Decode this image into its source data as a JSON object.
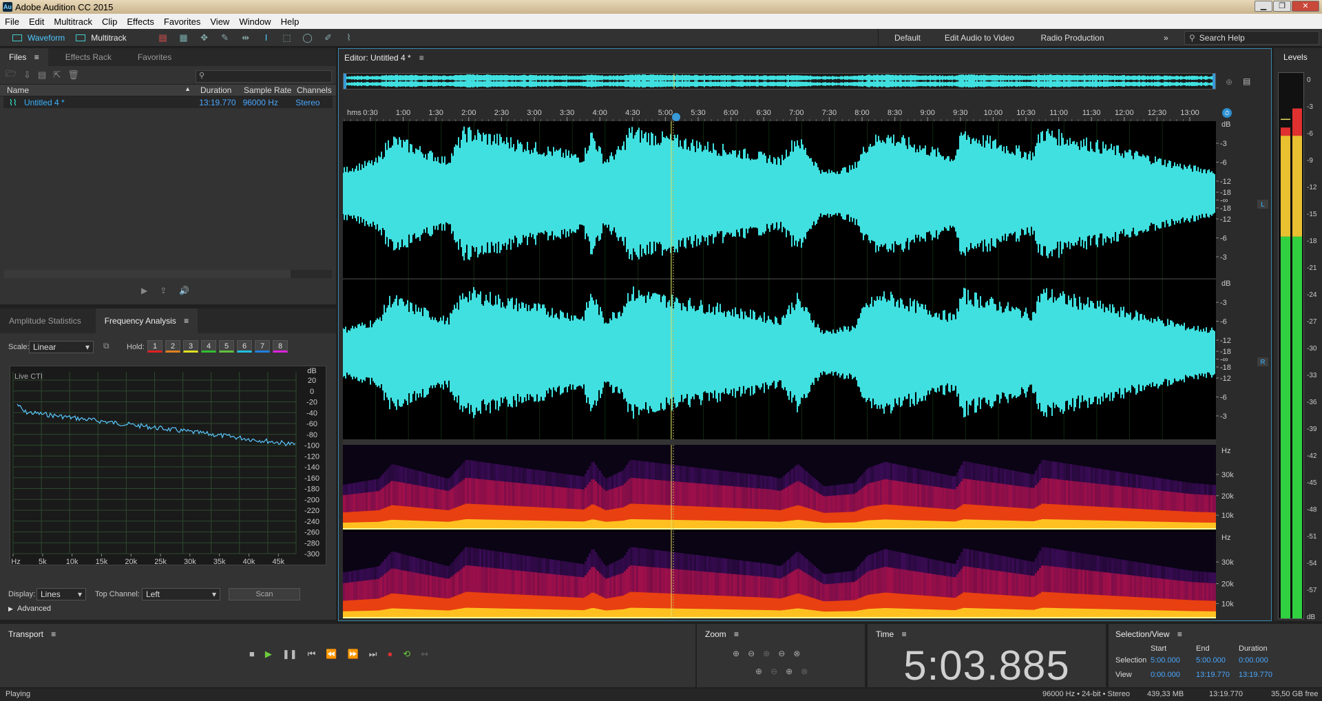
{
  "app": {
    "title": "Adobe Audition CC 2015",
    "logo": "Au"
  },
  "menu": [
    "File",
    "Edit",
    "Multitrack",
    "Clip",
    "Effects",
    "Favorites",
    "View",
    "Window",
    "Help"
  ],
  "toolbar": {
    "waveform": "Waveform",
    "multitrack": "Multitrack"
  },
  "workspaces": {
    "default": "Default",
    "edit_video": "Edit Audio to Video",
    "radio": "Radio Production",
    "more": "»",
    "search_placeholder": "Search Help"
  },
  "files_panel": {
    "tabs": [
      "Files",
      "Effects Rack",
      "Favorites"
    ],
    "search_glyph": "⚲",
    "columns": [
      "Name",
      "Duration",
      "Sample Rate",
      "Channels"
    ],
    "rows": [
      {
        "name": "Untitled 4 *",
        "duration": "13:19.770",
        "sample_rate": "96000 Hz",
        "channels": "Stereo"
      }
    ]
  },
  "freq_panel": {
    "tabs": [
      "Amplitude Statistics",
      "Frequency Analysis"
    ],
    "scale_label": "Scale:",
    "scale_value": "Linear",
    "hold_label": "Hold:",
    "hold_buttons": [
      "1",
      "2",
      "3",
      "4",
      "5",
      "6",
      "7",
      "8"
    ],
    "hold_colors": [
      "#e02020",
      "#e08020",
      "#e0e020",
      "#30c030",
      "#60c040",
      "#20c0e0",
      "#2080e0",
      "#e020e0"
    ],
    "live_cti": "Live CTI",
    "db_label": "dB",
    "db_ticks": [
      "20",
      "0",
      "-20",
      "-40",
      "-60",
      "-80",
      "-100",
      "-120",
      "-140",
      "-160",
      "-180",
      "-200",
      "-220",
      "-240",
      "-260",
      "-280",
      "-300"
    ],
    "hz_ticks": [
      "Hz",
      "5k",
      "10k",
      "15k",
      "20k",
      "25k",
      "30k",
      "35k",
      "40k",
      "45k"
    ],
    "display_label": "Display:",
    "display_value": "Lines",
    "top_channel_label": "Top Channel:",
    "top_channel_value": "Left",
    "scan": "Scan",
    "advanced": "Advanced"
  },
  "editor": {
    "title": "Editor: Untitled 4 *",
    "ruler_unit": "hms",
    "ruler": [
      "0:30",
      "1:00",
      "1:30",
      "2:00",
      "2:30",
      "3:00",
      "3:30",
      "4:00",
      "4:30",
      "5:00",
      "5:30",
      "6:00",
      "6:30",
      "7:00",
      "7:30",
      "8:00",
      "8:30",
      "9:00",
      "9:30",
      "10:00",
      "10:30",
      "11:00",
      "11:30",
      "12:00",
      "12:30",
      "13:00"
    ],
    "db_label": "dB",
    "db_scale_top": [
      "-3",
      "-6",
      "-12",
      "-18",
      "-∞",
      "-18",
      "-12",
      "-6",
      "-3"
    ],
    "channel_L": "L",
    "channel_R": "R",
    "hz_label": "Hz",
    "hz_scale": [
      "30k",
      "20k",
      "10k"
    ]
  },
  "levels": {
    "title": "Levels",
    "scale": [
      "0",
      "-3",
      "-6",
      "-9",
      "-12",
      "-15",
      "-18",
      "-21",
      "-24",
      "-27",
      "-30",
      "-33",
      "-36",
      "-39",
      "-42",
      "-45",
      "-48",
      "-51",
      "-54",
      "-57",
      "dB"
    ]
  },
  "transport": {
    "title": "Transport"
  },
  "zoom": {
    "title": "Zoom"
  },
  "time": {
    "title": "Time",
    "value": "5:03.885"
  },
  "selection_view": {
    "title": "Selection/View",
    "headers": [
      "Start",
      "End",
      "Duration"
    ],
    "rows": [
      {
        "label": "Selection",
        "start": "5:00.000",
        "end": "5:00.000",
        "duration": "0:00.000"
      },
      {
        "label": "View",
        "start": "0:00.000",
        "end": "13:19.770",
        "duration": "13:19.770"
      }
    ]
  },
  "status": {
    "playing": "Playing",
    "format": "96000 Hz • 24-bit • Stereo",
    "size": "439,33 MB",
    "duration": "13:19.770",
    "free": "35,50 GB free"
  }
}
